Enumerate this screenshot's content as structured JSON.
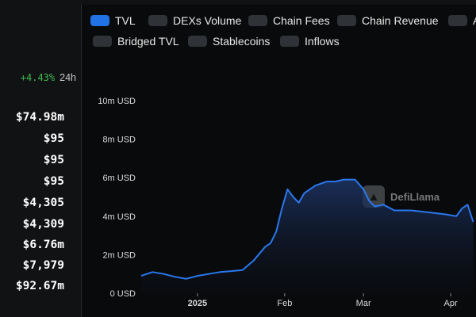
{
  "stats": {
    "change_pct": "+4.43%",
    "change_period": "24h",
    "values": [
      "$74.98m",
      "$95",
      "$95",
      "$95",
      "$4,305",
      "$4,309",
      "$6.76m",
      "$7,979",
      "$92.67m"
    ]
  },
  "toggles": [
    {
      "label": "TVL",
      "active": true
    },
    {
      "label": "DEXs Volume",
      "active": false
    },
    {
      "label": "Chain Fees",
      "active": false
    },
    {
      "label": "Chain Revenue",
      "active": false
    },
    {
      "label": "A",
      "active": false
    },
    {
      "label": "Bridged TVL",
      "active": false
    },
    {
      "label": "Stablecoins",
      "active": false
    },
    {
      "label": "Inflows",
      "active": false
    }
  ],
  "watermark": {
    "text": "DefiLlama"
  },
  "colors": {
    "accent": "#2172e5",
    "positive": "#3fb950",
    "background": "#090a0b"
  },
  "chart_data": {
    "type": "area",
    "series": [
      {
        "name": "TVL",
        "unit": "USD"
      }
    ],
    "y_ticks": [
      "0 USD",
      "2m USD",
      "4m USD",
      "6m USD",
      "8m USD",
      "10m USD"
    ],
    "ylim": [
      0,
      10000000
    ],
    "x_ticks": [
      "2025",
      "Feb",
      "Mar",
      "Apr"
    ],
    "x": [
      "2024-12-12",
      "2024-12-16",
      "2024-12-20",
      "2024-12-24",
      "2024-12-28",
      "2025-01-01",
      "2025-01-05",
      "2025-01-09",
      "2025-01-13",
      "2025-01-17",
      "2025-01-21",
      "2025-01-25",
      "2025-01-27",
      "2025-01-29",
      "2025-01-31",
      "2025-02-02",
      "2025-02-04",
      "2025-02-06",
      "2025-02-08",
      "2025-02-12",
      "2025-02-16",
      "2025-02-19",
      "2025-02-22",
      "2025-02-26",
      "2025-03-01",
      "2025-03-03",
      "2025-03-05",
      "2025-03-08",
      "2025-03-12",
      "2025-03-18",
      "2025-03-24",
      "2025-03-30",
      "2025-04-03",
      "2025-04-05",
      "2025-04-07",
      "2025-04-09"
    ],
    "y": [
      900000,
      1100000,
      1000000,
      850000,
      750000,
      900000,
      1000000,
      1100000,
      1150000,
      1200000,
      1700000,
      2400000,
      2600000,
      3200000,
      4400000,
      5400000,
      5000000,
      4700000,
      5200000,
      5600000,
      5800000,
      5800000,
      5900000,
      5900000,
      5400000,
      4800000,
      4500000,
      4600000,
      4300000,
      4300000,
      4200000,
      4100000,
      4000000,
      4400000,
      4600000,
      3700000
    ],
    "grid": false,
    "legend": "top"
  }
}
